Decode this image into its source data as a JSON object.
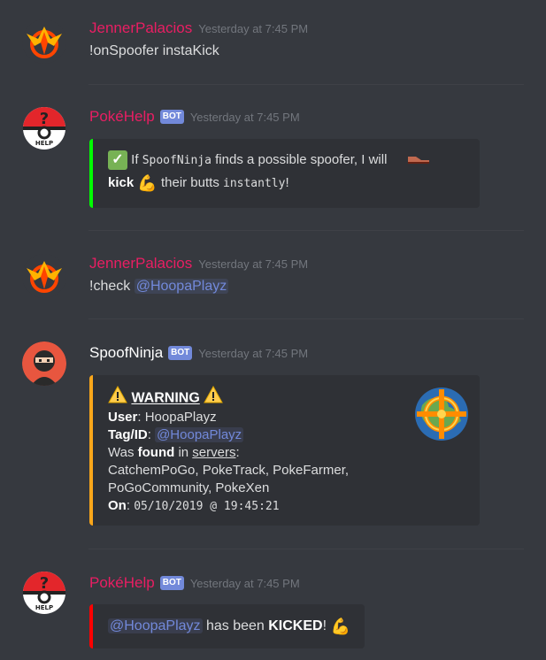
{
  "messages": [
    {
      "author": "JennerPalacios",
      "timestamp": "Yesterday at 7:45 PM",
      "text": "!onSpoofer instaKick"
    },
    {
      "author": "PokéHelp",
      "badge": "BOT",
      "timestamp": "Yesterday at 7:45 PM",
      "embed": {
        "color": "#00ff00",
        "line1_pre": "If ",
        "line1_code": "SpoofNinja",
        "line1_post": " finds a possible spoofer, I will",
        "line2_bold": "kick",
        "line2_mid": " their butts ",
        "line2_code": "instantly",
        "line2_end": "!"
      }
    },
    {
      "author": "JennerPalacios",
      "timestamp": "Yesterday at 7:45 PM",
      "text": "!check",
      "mention": "@HoopaPlayz"
    },
    {
      "author": "SpoofNinja",
      "badge": "BOT",
      "timestamp": "Yesterday at 7:45 PM",
      "embed": {
        "color": "#faa61a",
        "title": "WARNING",
        "user_label": "User",
        "user_value": "HoopaPlayz",
        "tag_label": "Tag/ID",
        "tag_value": "@HoopaPlayz",
        "was": "Was ",
        "found": "found",
        "in": " in ",
        "servers": "servers",
        "colon": ":",
        "server_line1": "CatchemPoGo, PokeTrack, PokeFarmer,",
        "server_line2": "PoGoCommunity, PokeXen",
        "on_label": "On",
        "on_value": "05/10/2019 @ 19:45:21"
      }
    },
    {
      "author": "PokéHelp",
      "badge": "BOT",
      "timestamp": "Yesterday at 7:45 PM",
      "embed": {
        "color": "#ff0000",
        "mention": "@HoopaPlayz",
        "mid": " has been ",
        "bold": "KICKED",
        "end": "!"
      }
    }
  ]
}
